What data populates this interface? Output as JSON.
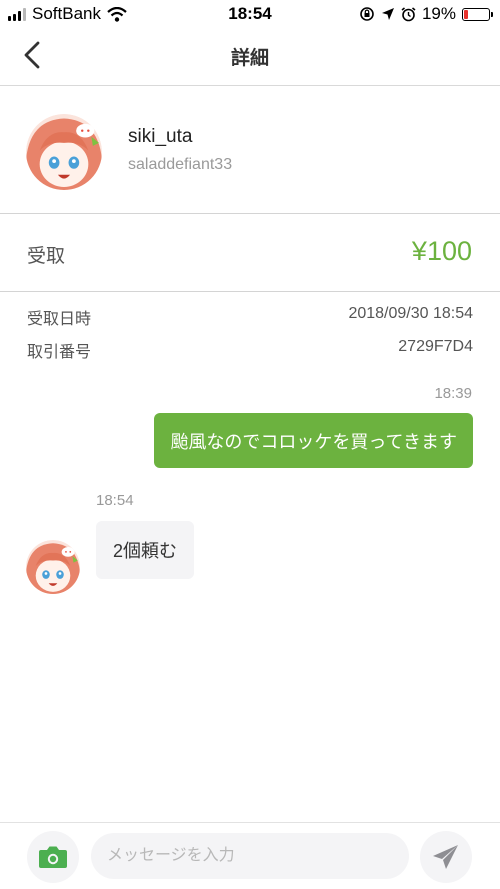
{
  "status_bar": {
    "carrier": "SoftBank",
    "time": "18:54",
    "battery": "19%",
    "battery_level": 0.19,
    "battery_color": "#e8322d"
  },
  "nav": {
    "title": "詳細",
    "back_icon": "chevron-left-icon"
  },
  "profile": {
    "name": "siki_uta",
    "handle": "saladdefiant33"
  },
  "transaction": {
    "type_label": "受取",
    "amount": "¥100",
    "amount_color": "#6cb23f",
    "details": [
      {
        "label": "受取日時",
        "value": "2018/09/30 18:54"
      },
      {
        "label": "取引番号",
        "value": "2729F7D4"
      }
    ]
  },
  "messages": [
    {
      "direction": "outgoing",
      "time": "18:39",
      "text": "颱風なのでコロッケを買ってきます",
      "bubble_color": "#6cb23f"
    },
    {
      "direction": "incoming",
      "time": "18:54",
      "text": "2個頼む",
      "bubble_color": "#f4f4f6"
    }
  ],
  "input_bar": {
    "placeholder": "メッセージを入力",
    "value": "",
    "camera_icon": "camera-icon",
    "send_icon": "send-icon",
    "camera_color": "#4caf50"
  }
}
